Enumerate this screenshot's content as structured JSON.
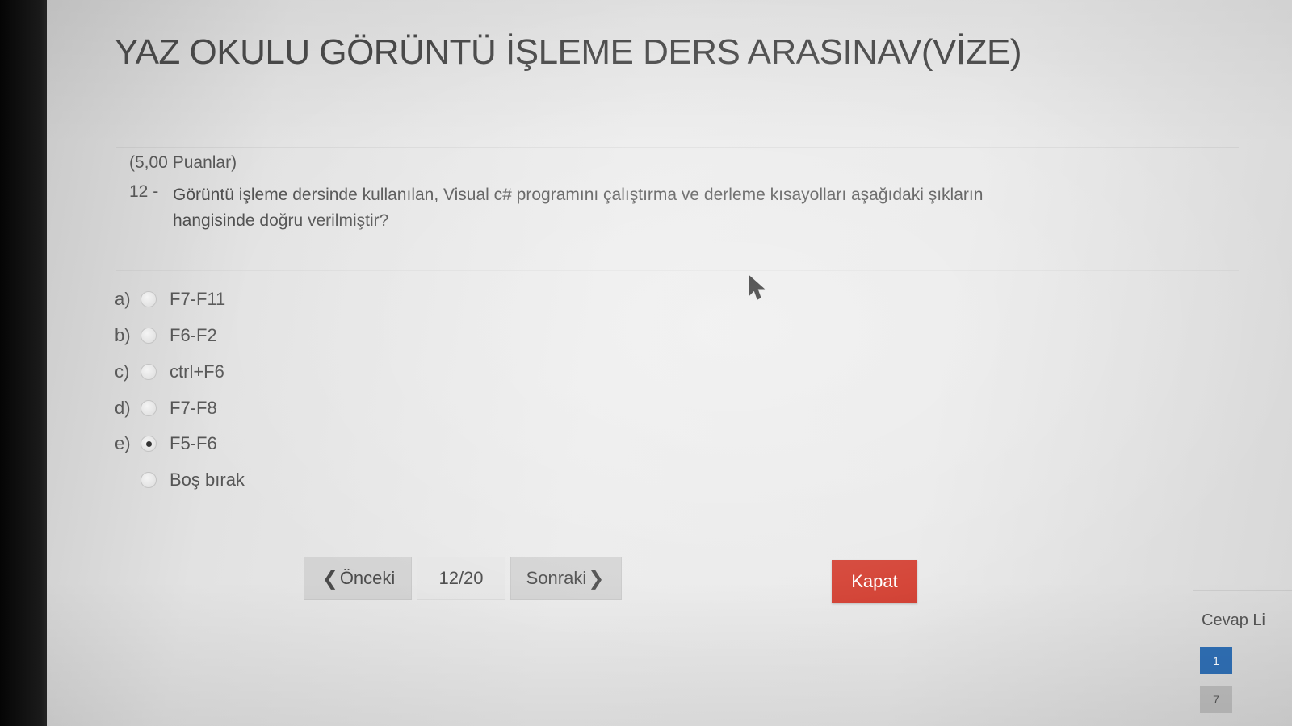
{
  "exam": {
    "title": "YAZ OKULU GÖRÜNTÜ İŞLEME DERS ARASINAV(VİZE)"
  },
  "question": {
    "points": "(5,00 Puanlar)",
    "number": "12 -",
    "text": "Görüntü işleme dersinde kullanılan, Visual c# programını çalıştırma ve derleme kısayolları aşağıdaki şıkların hangisinde doğru verilmiştir?"
  },
  "options": [
    {
      "letter": "a)",
      "label": "F7-F11",
      "selected": false
    },
    {
      "letter": "b)",
      "label": "F6-F2",
      "selected": false
    },
    {
      "letter": "c)",
      "label": "ctrl+F6",
      "selected": false
    },
    {
      "letter": "d)",
      "label": "F7-F8",
      "selected": false
    },
    {
      "letter": "e)",
      "label": "F5-F6",
      "selected": true
    },
    {
      "letter": "",
      "label": "Boş bırak",
      "selected": false
    }
  ],
  "navigation": {
    "prev_label": "Önceki",
    "page_indicator": "12/20",
    "next_label": "Sonraki",
    "close_label": "Kapat"
  },
  "answer_list": {
    "label": "Cevap Li",
    "items": [
      "1",
      "7"
    ]
  },
  "colors": {
    "close_button": "#d23a2c",
    "active_answer": "#2f6fb5"
  }
}
